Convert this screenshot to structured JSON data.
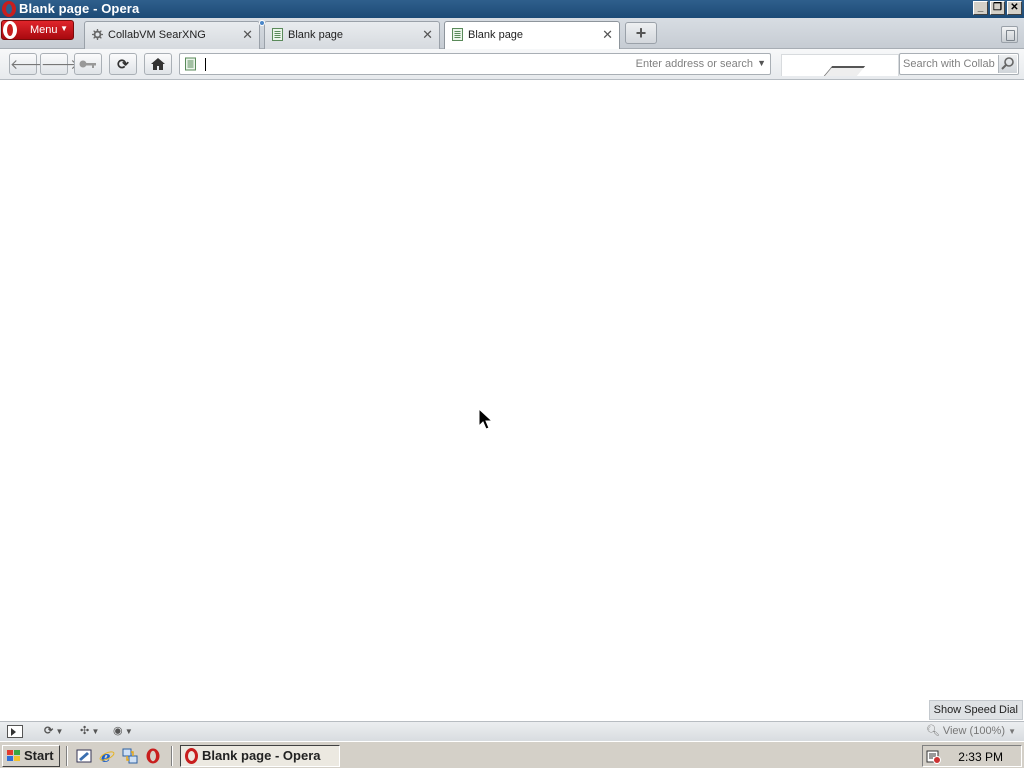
{
  "window": {
    "title": "Blank page - Opera"
  },
  "menu": {
    "label": "Menu"
  },
  "tabs": [
    {
      "label": "CollabVM SearXNG",
      "active": false,
      "icon": "gear-favicon-icon"
    },
    {
      "label": "Blank page",
      "active": false,
      "icon": "page-icon"
    },
    {
      "label": "Blank page",
      "active": true,
      "icon": "page-icon"
    }
  ],
  "toolbar": {
    "address_value": "",
    "address_placeholder": "Enter address or search",
    "search_placeholder": "Search with Collab"
  },
  "content": {
    "show_speed_dial": "Show Speed Dial"
  },
  "statusbar": {
    "view_zoom": "View (100%)"
  },
  "taskbar": {
    "start_label": "Start",
    "task_label": "Blank page - Opera",
    "clock": "2:33 PM"
  },
  "colors": {
    "titlebar": "#1c4a76",
    "menu_red": "#c81e1e",
    "taskbar": "#d4d0c8"
  }
}
